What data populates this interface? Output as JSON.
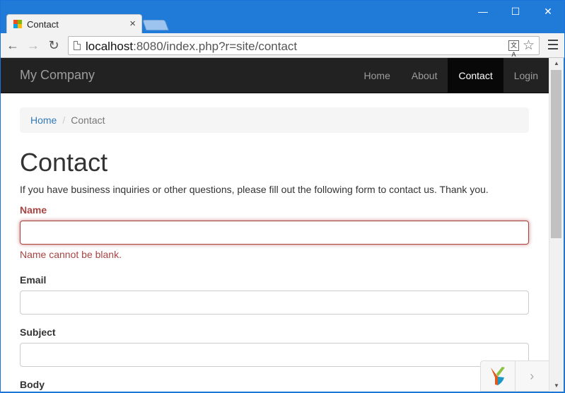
{
  "browser": {
    "tab_title": "Contact",
    "tab_close": "×",
    "url_host": "localhost",
    "url_rest": ":8080/index.php?r=site/contact",
    "translate_label": "文A",
    "window_controls": {
      "minimize": "—",
      "maximize": "☐",
      "close": "✕"
    },
    "nav": {
      "back": "←",
      "forward": "→",
      "reload": "↻"
    },
    "star": "☆"
  },
  "navbar": {
    "brand": "My Company",
    "items": [
      {
        "label": "Home"
      },
      {
        "label": "About"
      },
      {
        "label": "Contact",
        "active": true
      },
      {
        "label": "Login"
      }
    ]
  },
  "breadcrumb": {
    "home": "Home",
    "separator": "/",
    "current": "Contact"
  },
  "page": {
    "title": "Contact",
    "intro": "If you have business inquiries or other questions, please fill out the following form to contact us. Thank you."
  },
  "form": {
    "name": {
      "label": "Name",
      "value": "",
      "error": "Name cannot be blank."
    },
    "email": {
      "label": "Email",
      "value": ""
    },
    "subject": {
      "label": "Subject",
      "value": ""
    },
    "body": {
      "label": "Body"
    }
  },
  "debug_toolbar": {
    "toggle": "›"
  },
  "colors": {
    "chrome_blue": "#1f7ad8",
    "navbar_bg": "#222222",
    "error": "#a94442",
    "link": "#337ab7"
  }
}
